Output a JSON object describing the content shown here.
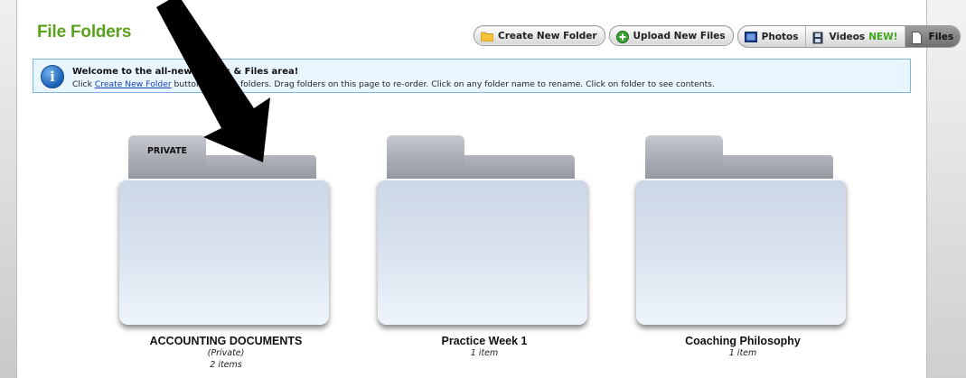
{
  "header": {
    "title": "File Folders",
    "buttons": {
      "create_folder": "Create New Folder",
      "upload_files": "Upload New Files"
    },
    "tabs": {
      "photos": "Photos",
      "videos": "Videos",
      "videos_badge": "NEW!",
      "files": "Files"
    }
  },
  "info_banner": {
    "title": "Welcome to the all-new Photos & Files area!",
    "text_prefix": "Click ",
    "link_text": "Create New Folder",
    "text_suffix": " button to make folders. Drag folders on this page to re-order. Click on any folder name to rename. Click on folder to see contents."
  },
  "folders": [
    {
      "name": "ACCOUNTING DOCUMENTS",
      "tab_label": "PRIVATE",
      "privacy": "(Private)",
      "count": "2 items"
    },
    {
      "name": "Practice Week 1",
      "tab_label": "",
      "privacy": "",
      "count": "1 item"
    },
    {
      "name": "Coaching Philosophy",
      "tab_label": "",
      "privacy": "",
      "count": "1 item"
    }
  ],
  "colors": {
    "title_green": "#5aa21d",
    "info_bg": "#eaf6ff",
    "info_border": "#7fb7df",
    "link_blue": "#1540b3",
    "new_badge_green": "#3fa51a"
  },
  "icons": {
    "create_folder": "folder-icon",
    "upload_files": "plus-circle-icon",
    "photos": "photo-icon",
    "videos": "film-icon",
    "files": "document-icon",
    "info": "info-icon",
    "annotation": "arrow-icon"
  }
}
